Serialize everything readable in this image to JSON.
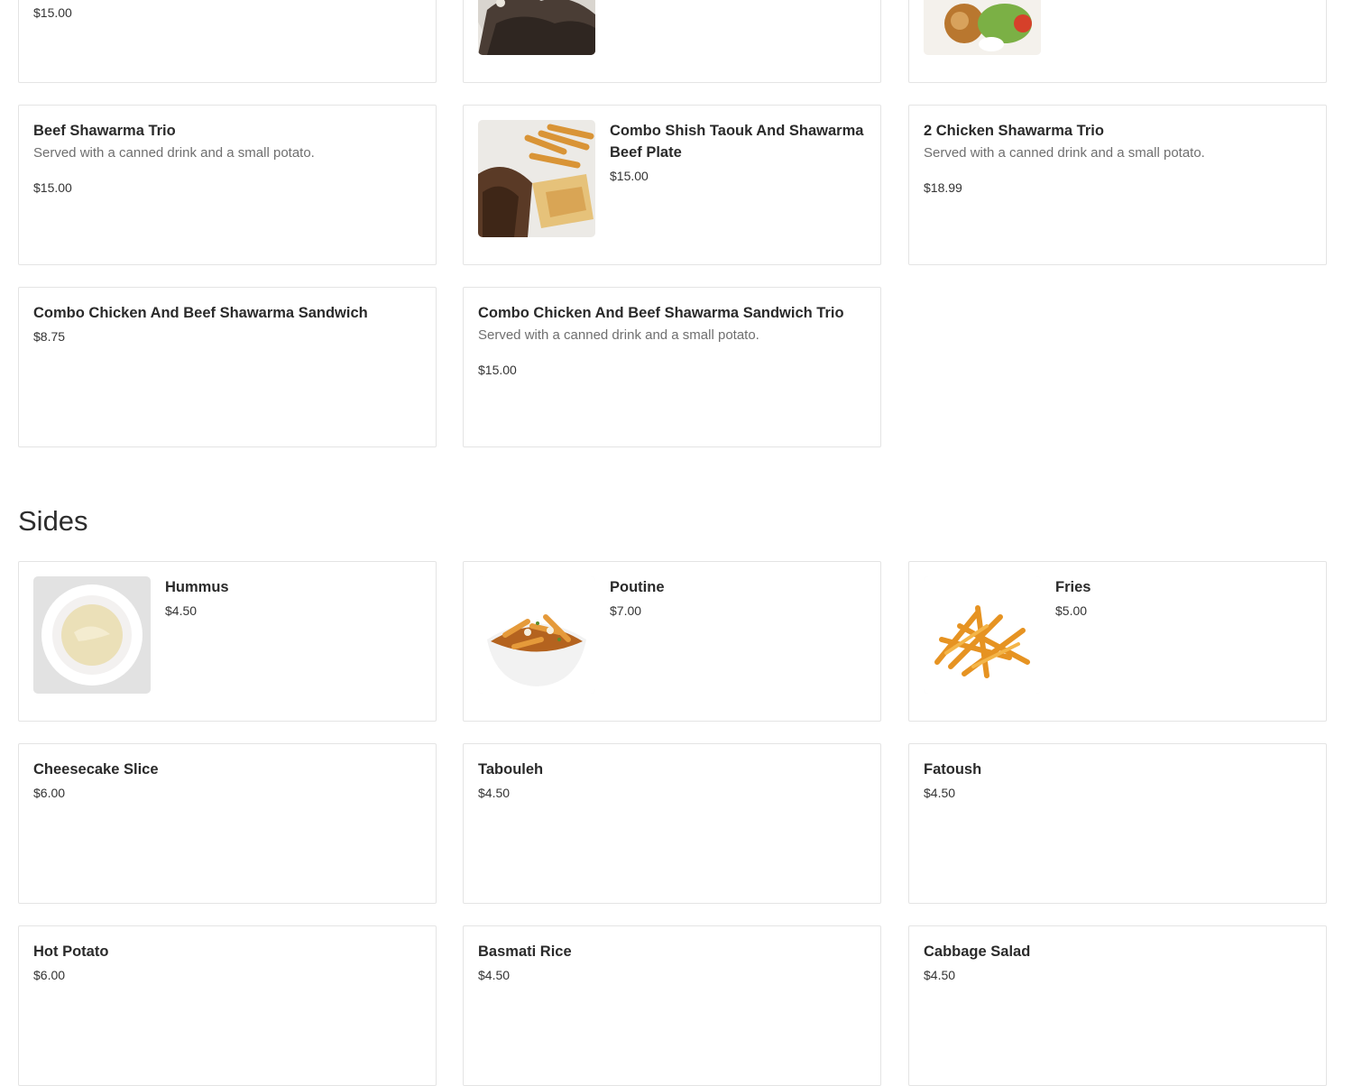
{
  "top_row": {
    "price_left": "$15.00"
  },
  "plates_rows": [
    {
      "items": [
        {
          "title": "Beef Shawarma Trio",
          "desc": "Served with a canned drink and a small potato.",
          "price": "$15.00"
        },
        {
          "title": "Combo Shish Taouk And Shawarma Beef Plate",
          "price": "$15.00",
          "image": "shawarma-plate-photo"
        },
        {
          "title": "2 Chicken Shawarma Trio",
          "desc": "Served with a canned drink and a small potato.",
          "price": "$18.99"
        }
      ]
    },
    {
      "items": [
        {
          "title": "Combo Chicken And Beef Shawarma Sandwich",
          "price": "$8.75"
        },
        {
          "title": "Combo Chicken And Beef Shawarma Sandwich Trio",
          "desc": "Served with a canned drink and a small potato.",
          "price": "$15.00"
        }
      ]
    }
  ],
  "sides": {
    "heading": "Sides",
    "items": [
      {
        "title": "Hummus",
        "price": "$4.50",
        "image": "hummus-photo"
      },
      {
        "title": "Poutine",
        "price": "$7.00",
        "image": "poutine-photo"
      },
      {
        "title": "Fries",
        "price": "$5.00",
        "image": "fries-photo"
      },
      {
        "title": "Cheesecake Slice",
        "price": "$6.00"
      },
      {
        "title": "Tabouleh",
        "price": "$4.50"
      },
      {
        "title": "Fatoush",
        "price": "$4.50"
      },
      {
        "title": "Hot Potato",
        "price": "$6.00"
      },
      {
        "title": "Basmati Rice",
        "price": "$4.50"
      },
      {
        "title": "Cabbage Salad",
        "price": "$4.50"
      }
    ]
  }
}
